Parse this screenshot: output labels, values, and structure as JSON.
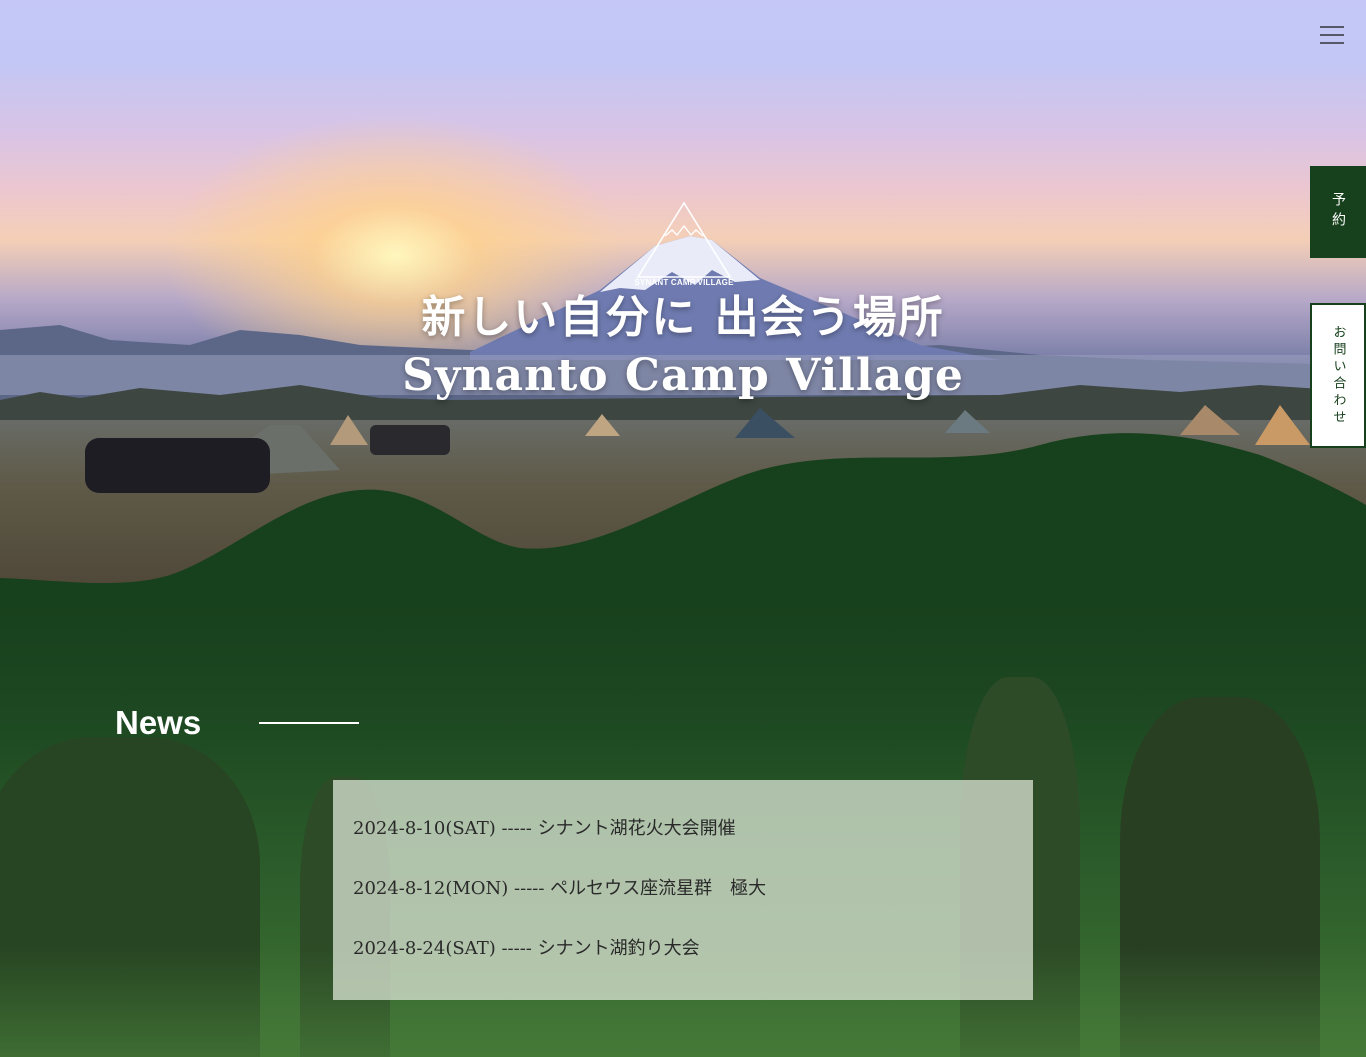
{
  "header": {
    "menu_icon": "hamburger-icon"
  },
  "hero": {
    "logo_text": "SYNANT CAMP VILLAGE",
    "title_line1": "新しい自分に 出会う場所",
    "title_line2": "Synanto Camp Village"
  },
  "side_buttons": {
    "reserve_label": "予約",
    "contact_label": "お問い合わせ"
  },
  "news": {
    "heading": "News",
    "items": [
      {
        "text": "2024-8-10(SAT) ----- シナント湖花火大会開催"
      },
      {
        "text": "2024-8-12(MON) ----- ペルセウス座流星群　極大"
      },
      {
        "text": "2024-8-24(SAT) ----- シナント湖釣り大会"
      }
    ]
  },
  "colors": {
    "brand_green": "#17401c",
    "white": "#ffffff"
  }
}
